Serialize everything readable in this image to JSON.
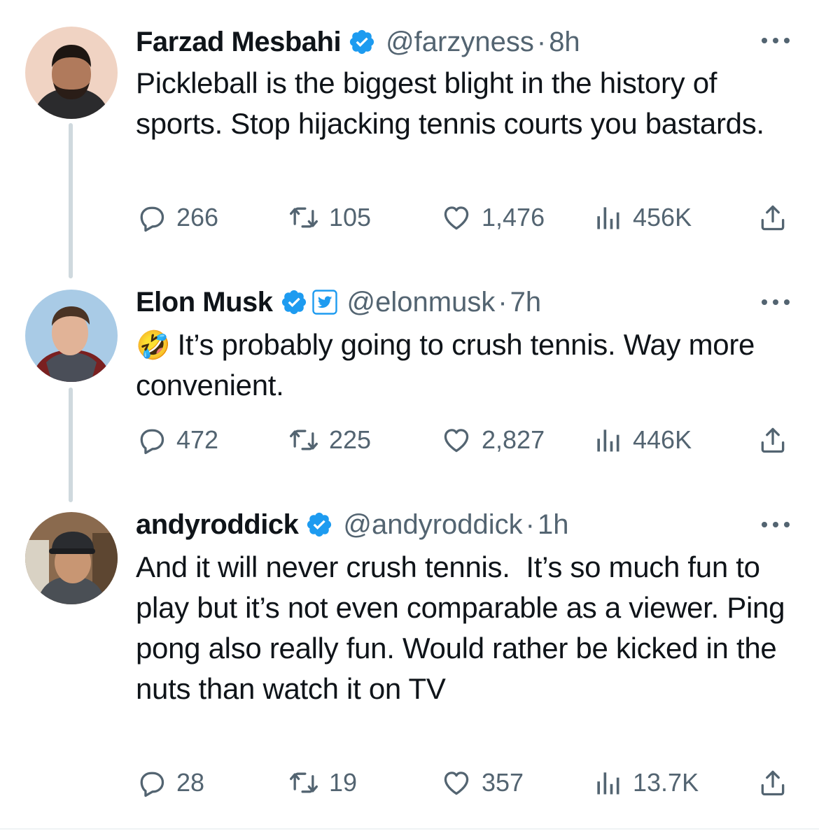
{
  "colors": {
    "verified": "#1d9bf0",
    "secondary_text": "#536471",
    "thread_line": "#cfd9de"
  },
  "tweets": [
    {
      "name": "Farzad Mesbahi",
      "handle": "@farzyness",
      "separator": "·",
      "time": "8h",
      "text": "Pickleball is the biggest blight in the history of sports. Stop hijacking tennis courts you bastards.",
      "replies": "266",
      "retweets": "105",
      "likes": "1,476",
      "views": "456K",
      "icons": [
        "verified-badge-icon",
        "more-options-icon",
        "reply-icon",
        "retweet-icon",
        "like-icon",
        "views-icon",
        "share-icon"
      ]
    },
    {
      "name": "Elon Musk",
      "handle": "@elonmusk",
      "separator": "·",
      "time": "7h",
      "emoji": "🤣",
      "text": "It’s probably going to crush tennis. Way more convenient.",
      "replies": "472",
      "retweets": "225",
      "likes": "2,827",
      "views": "446K",
      "icons": [
        "verified-badge-icon",
        "twitter-affiliate-badge-icon",
        "more-options-icon",
        "reply-icon",
        "retweet-icon",
        "like-icon",
        "views-icon",
        "share-icon"
      ]
    },
    {
      "name": "andyroddick",
      "handle": "@andyroddick",
      "separator": "·",
      "time": "1h",
      "text": "And it will never crush tennis.  It’s so much fun to play but it’s not even comparable as a viewer. Ping pong also really fun. Would rather be kicked in the nuts than watch it on TV",
      "replies": "28",
      "retweets": "19",
      "likes": "357",
      "views": "13.7K",
      "icons": [
        "verified-badge-icon",
        "more-options-icon",
        "reply-icon",
        "retweet-icon",
        "like-icon",
        "views-icon",
        "share-icon"
      ]
    }
  ]
}
